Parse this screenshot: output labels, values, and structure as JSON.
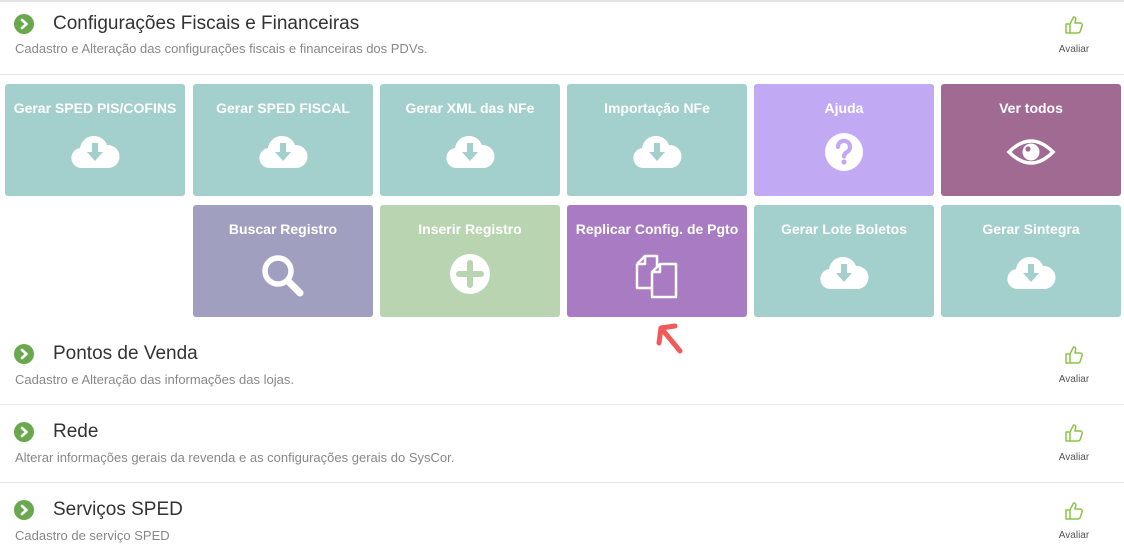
{
  "sections": [
    {
      "title": "Configurações Fiscais e Financeiras",
      "desc": "Cadastro e Alteração das configurações fiscais e financeiras dos PDVs.",
      "rate": "Avaliar"
    },
    {
      "title": "Pontos de Venda",
      "desc": "Cadastro e Alteração das informações das lojas.",
      "rate": "Avaliar"
    },
    {
      "title": "Rede",
      "desc": "Alterar informações gerais da revenda e as configurações gerais do SysCor.",
      "rate": "Avaliar"
    },
    {
      "title": "Serviços SPED",
      "desc": "Cadastro de serviço SPED",
      "rate": "Avaliar"
    }
  ],
  "tiles": [
    {
      "label": "Gerar SPED PIS/COFINS",
      "icon": "cloud-download-icon",
      "color": "#a3cfcd"
    },
    {
      "label": "Gerar SPED FISCAL",
      "icon": "cloud-download-icon",
      "color": "#a3cfcd"
    },
    {
      "label": "Gerar XML das NFe",
      "icon": "cloud-download-icon",
      "color": "#a3cfcd"
    },
    {
      "label": "Importação NFe",
      "icon": "cloud-download-icon",
      "color": "#a3cfcd"
    },
    {
      "label": "Ajuda",
      "icon": "question-icon",
      "color": "#c2a9f4"
    },
    {
      "label": "Ver todos",
      "icon": "eye-icon",
      "color": "#a16a93"
    },
    {
      "label": "Buscar Registro",
      "icon": "search-icon",
      "color": "#a09fc0"
    },
    {
      "label": "Inserir Registro",
      "icon": "plus-circle-icon",
      "color": "#b9d4b1"
    },
    {
      "label": "Replicar Config. de Pgto",
      "icon": "copy-icon",
      "color": "#a97bc2"
    },
    {
      "label": "Gerar Lote Boletos",
      "icon": "cloud-download-icon",
      "color": "#a3cfcd"
    },
    {
      "label": "Gerar Sintegra",
      "icon": "cloud-download-icon",
      "color": "#a3cfcd"
    }
  ],
  "colors": {
    "accent_green": "#6aa84f",
    "arrow_red": "#f05a5a"
  }
}
